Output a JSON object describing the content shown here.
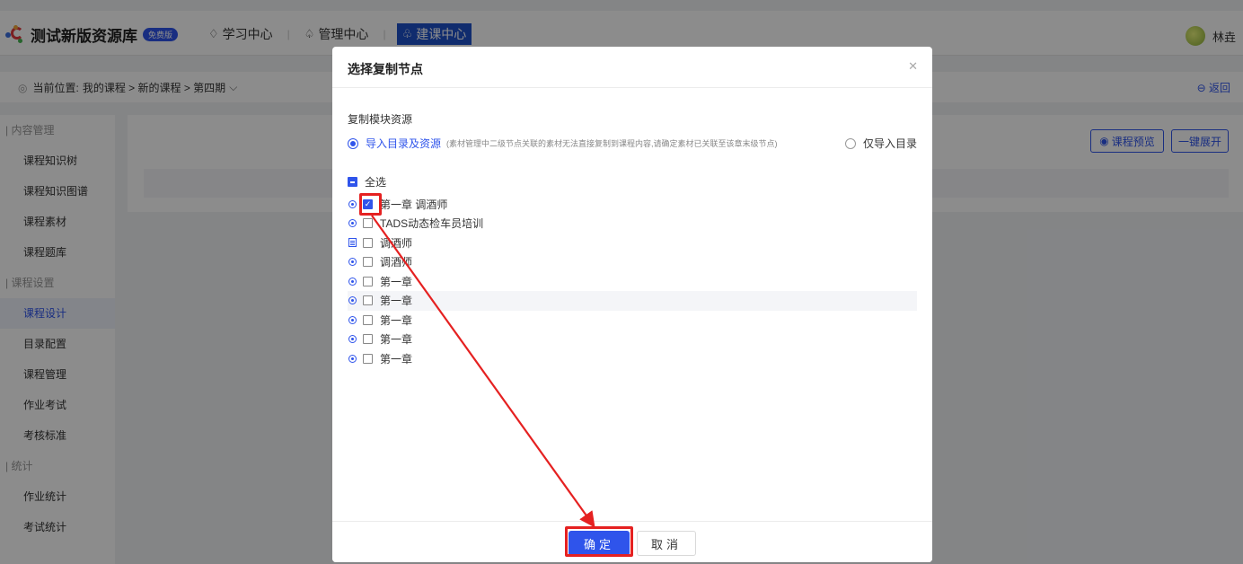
{
  "header": {
    "logo_text": "测试新版资源库",
    "badge": "免费版",
    "nav": [
      {
        "label": "学习中心",
        "icon": "graduation-icon"
      },
      {
        "label": "管理中心",
        "icon": "people-icon"
      },
      {
        "label": "建课中心",
        "icon": "build-icon"
      }
    ],
    "user_name": "林垚"
  },
  "breadcrumb": {
    "prefix": "当前位置:",
    "path": "我的课程 > 新的课程 > 第四期",
    "back_label": "返回"
  },
  "sidebar": {
    "groups": [
      {
        "title": "内容管理",
        "items": [
          "课程知识树",
          "课程知识图谱",
          "课程素材",
          "课程题库"
        ]
      },
      {
        "title": "课程设置",
        "items": [
          "课程设计",
          "目录配置",
          "课程管理",
          "作业考试",
          "考核标准"
        ]
      },
      {
        "title": "统计",
        "items": [
          "作业统计",
          "考试统计"
        ]
      }
    ],
    "active": "课程设计"
  },
  "content": {
    "preview_label": "课程预览",
    "expand_label": "一键展开"
  },
  "modal": {
    "title": "选择复制节点",
    "section_label": "复制模块资源",
    "option_1_label": "导入目录及资源",
    "option_1_note": "(素材管理中二级节点关联的素材无法直接复制到课程内容,请确定素材已关联至该章末级节点)",
    "option_2_label": "仅导入目录",
    "select_all_label": "全选",
    "tree": [
      {
        "label": "第一章 调酒师",
        "checked": true,
        "icon": "expand"
      },
      {
        "label": "TADS动态检车员培训",
        "checked": false,
        "icon": "expand"
      },
      {
        "label": "调酒师",
        "checked": false,
        "icon": "doc"
      },
      {
        "label": "调酒师",
        "checked": false,
        "icon": "expand"
      },
      {
        "label": "第一章",
        "checked": false,
        "icon": "expand"
      },
      {
        "label": "第一章",
        "checked": false,
        "icon": "expand"
      },
      {
        "label": "第一章",
        "checked": false,
        "icon": "expand"
      },
      {
        "label": "第一章",
        "checked": false,
        "icon": "expand"
      },
      {
        "label": "第一章",
        "checked": false,
        "icon": "expand"
      }
    ],
    "ok_label": "确定",
    "cancel_label": "取消"
  },
  "colors": {
    "accent": "#2f54eb",
    "annotation": "#e52121"
  }
}
